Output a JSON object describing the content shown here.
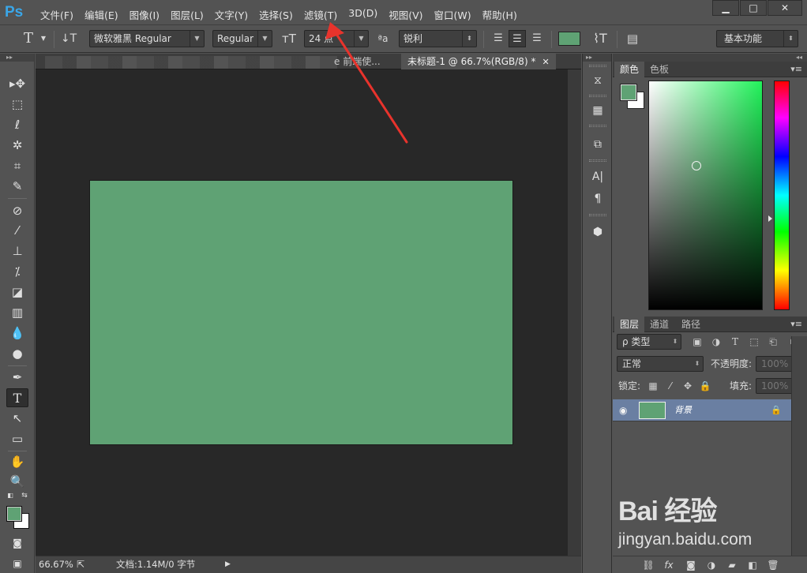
{
  "app": {
    "logo": "Ps"
  },
  "menubar": {
    "items": [
      "文件(F)",
      "编辑(E)",
      "图像(I)",
      "图层(L)",
      "文字(Y)",
      "选择(S)",
      "滤镜(T)",
      "3D(D)",
      "视图(V)",
      "窗口(W)",
      "帮助(H)"
    ]
  },
  "window_controls": {
    "minimize": "▁",
    "maximize": "□",
    "close": "✕"
  },
  "options": {
    "font_family": "微软雅黑 Regular",
    "font_style": "Regular",
    "font_size": "24 点",
    "antialias_label": "ªa",
    "antialias": "锐利",
    "workspace": "基本功能",
    "color": "#5fa274"
  },
  "tabs": [
    {
      "label": "e 前端使..."
    },
    {
      "label": "未标题-1 @ 66.7%(RGB/8) *",
      "active": true
    }
  ],
  "status": {
    "zoom": "66.67%",
    "doc_info": "文档:1.14M/0 字节"
  },
  "panels": {
    "color_tabs": [
      "颜色",
      "色板"
    ],
    "layer_tabs": [
      "图层",
      "通道",
      "路径"
    ],
    "fg_color": "#5fa274",
    "bg_color": "#ffffff"
  },
  "layers": {
    "filter_kind": "ρ 类型",
    "blend_mode": "正常",
    "opacity_label": "不透明度:",
    "opacity": "100%",
    "lock_label": "锁定:",
    "fill_label": "填充:",
    "fill": "100%",
    "rows": [
      {
        "name": "背景",
        "visible": true,
        "locked": true
      }
    ]
  },
  "canvas": {
    "fill_color": "#5fa274"
  },
  "watermark": {
    "logo": "Bai 经验",
    "url": "jingyan.baidu.com"
  }
}
